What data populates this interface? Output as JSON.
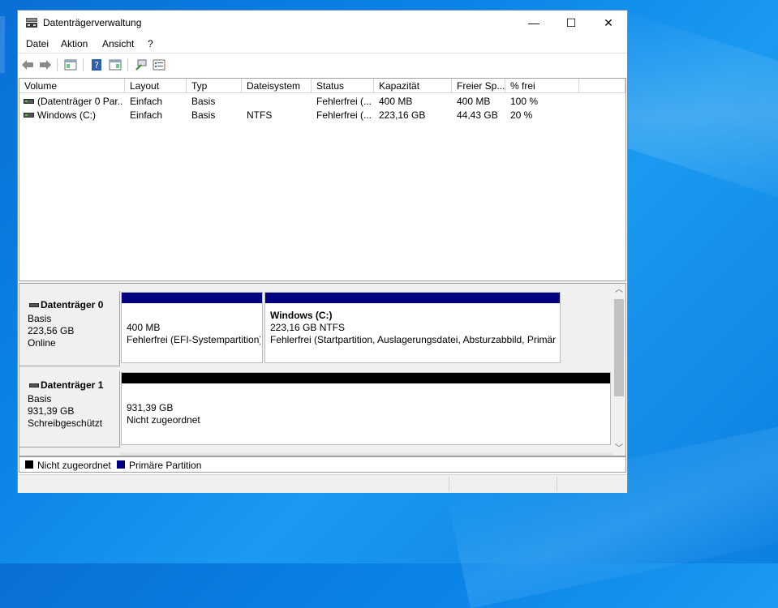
{
  "window": {
    "title": "Datenträgerverwaltung"
  },
  "titlebar": {
    "minimize": "—",
    "maximize": "☐",
    "close": "✕"
  },
  "menu": [
    "Datei",
    "Aktion",
    "Ansicht",
    "?"
  ],
  "toolbar": {
    "icons": [
      "back-arrow-icon",
      "forward-arrow-icon",
      "show-hide-console-tree-icon",
      "help-icon",
      "properties-icon",
      "connect-icon",
      "list-view-icon"
    ]
  },
  "columns": [
    "Volume",
    "Layout",
    "Typ",
    "Dateisystem",
    "Status",
    "Kapazität",
    "Freier Sp...",
    "% frei"
  ],
  "volumes": [
    {
      "volume": "(Datenträger 0 Par...",
      "layout": "Einfach",
      "typ": "Basis",
      "dateisystem": "",
      "status": "Fehlerfrei (...",
      "kapazitaet": "400 MB",
      "frei": "400 MB",
      "prozent": "100 %"
    },
    {
      "volume": "Windows (C:)",
      "layout": "Einfach",
      "typ": "Basis",
      "dateisystem": "NTFS",
      "status": "Fehlerfrei (...",
      "kapazitaet": "223,16 GB",
      "frei": "44,43 GB",
      "prozent": "20 %"
    }
  ],
  "disks": [
    {
      "name": "Datenträger 0",
      "type": "Basis",
      "size": "223,56 GB",
      "state": "Online",
      "partitions": [
        {
          "title": "",
          "line1": "400 MB",
          "line2": "Fehlerfrei (EFI-Systempartition)"
        },
        {
          "title": "Windows  (C:)",
          "line1": "223,16 GB NTFS",
          "line2": "Fehlerfrei (Startpartition, Auslagerungsdatei, Absturzabbild, Primär"
        }
      ]
    },
    {
      "name": "Datenträger 1",
      "type": "Basis",
      "size": "931,39 GB",
      "state": "Schreibgeschützt",
      "partitions": [
        {
          "title": "",
          "line1": "931,39 GB",
          "line2": "Nicht zugeordnet"
        }
      ]
    }
  ],
  "legend": [
    {
      "label": "Nicht zugeordnet",
      "color": "#000000"
    },
    {
      "label": "Primäre Partition",
      "color": "#000080"
    }
  ],
  "colors": {
    "primary": "#000080",
    "unallocated": "#000000"
  }
}
